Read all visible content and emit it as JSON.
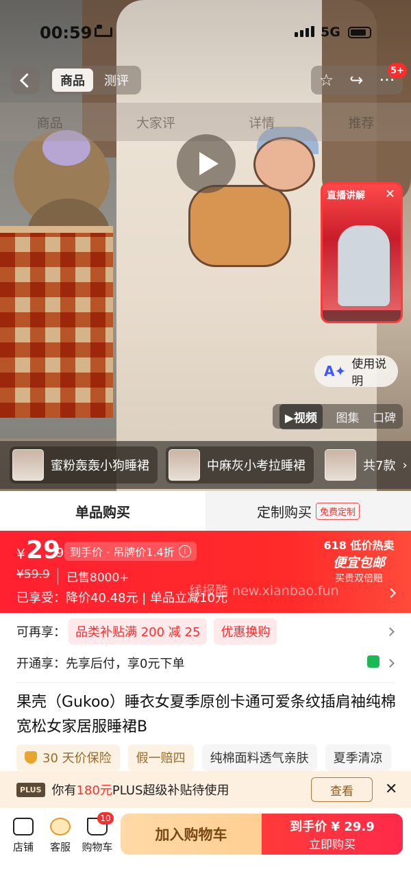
{
  "status": {
    "time": "00:59",
    "network": "5G"
  },
  "nav": {
    "segments": [
      "商品",
      "测评"
    ],
    "cart_badge": "5+"
  },
  "section_tabs": [
    "商品",
    "大家评",
    "详情",
    "推荐"
  ],
  "live": {
    "label": "直播讲解"
  },
  "ai_button": {
    "label": "使用说明"
  },
  "media_tabs": [
    "视频",
    "图集",
    "口碑"
  ],
  "variants": [
    "蜜粉轰轰小狗睡裙",
    "中麻灰小考拉睡裙"
  ],
  "variant_count": "共7款",
  "buy_tabs": {
    "single": "单品购买",
    "custom": "定制购买",
    "custom_tag": "免费定制"
  },
  "price": {
    "currency": "¥",
    "integer": "29",
    "decimal": ".9",
    "chip": "到手价 · 吊牌价1.4折",
    "original": "¥59.9",
    "sold": "已售8000+",
    "enjoyed": "已享受：降价40.48元 | 单品立减10元",
    "promo_line1": "618 低价热卖",
    "promo_line2": "便宜包邮",
    "promo_line3": "买贵双倍赔"
  },
  "watermark": "线报酷 new.xianbao.fun",
  "coupons": {
    "label": "可再享：",
    "items": [
      "品类补贴满 200 减 25",
      "优惠换购"
    ]
  },
  "paylater": "开通享：先享后付，享0元下单",
  "product_title": "果壳（Gukoo）睡衣女夏季原创卡通可爱条纹插肩袖纯棉宽松女家居服睡裙B",
  "features": [
    "30 天价保险",
    "假一赔四",
    "纯棉面料透气亲肤",
    "夏季清凉"
  ],
  "plus_bar": {
    "logo": "PLUS",
    "pre": "你有",
    "amount": "180元",
    "post": "PLUS超级补贴待使用",
    "action": "查看"
  },
  "bottom": {
    "store": "店铺",
    "service": "客服",
    "cart": "购物车",
    "cart_badge": "10",
    "add_to_cart": "加入购物车",
    "buy_line1": "到手价 ¥ 29.9",
    "buy_line2": "立即购买"
  },
  "colors": {
    "accent_red": "#ff2c2c",
    "cart_button": "#ffcf94",
    "plus_bg": "#fdf0e0"
  }
}
